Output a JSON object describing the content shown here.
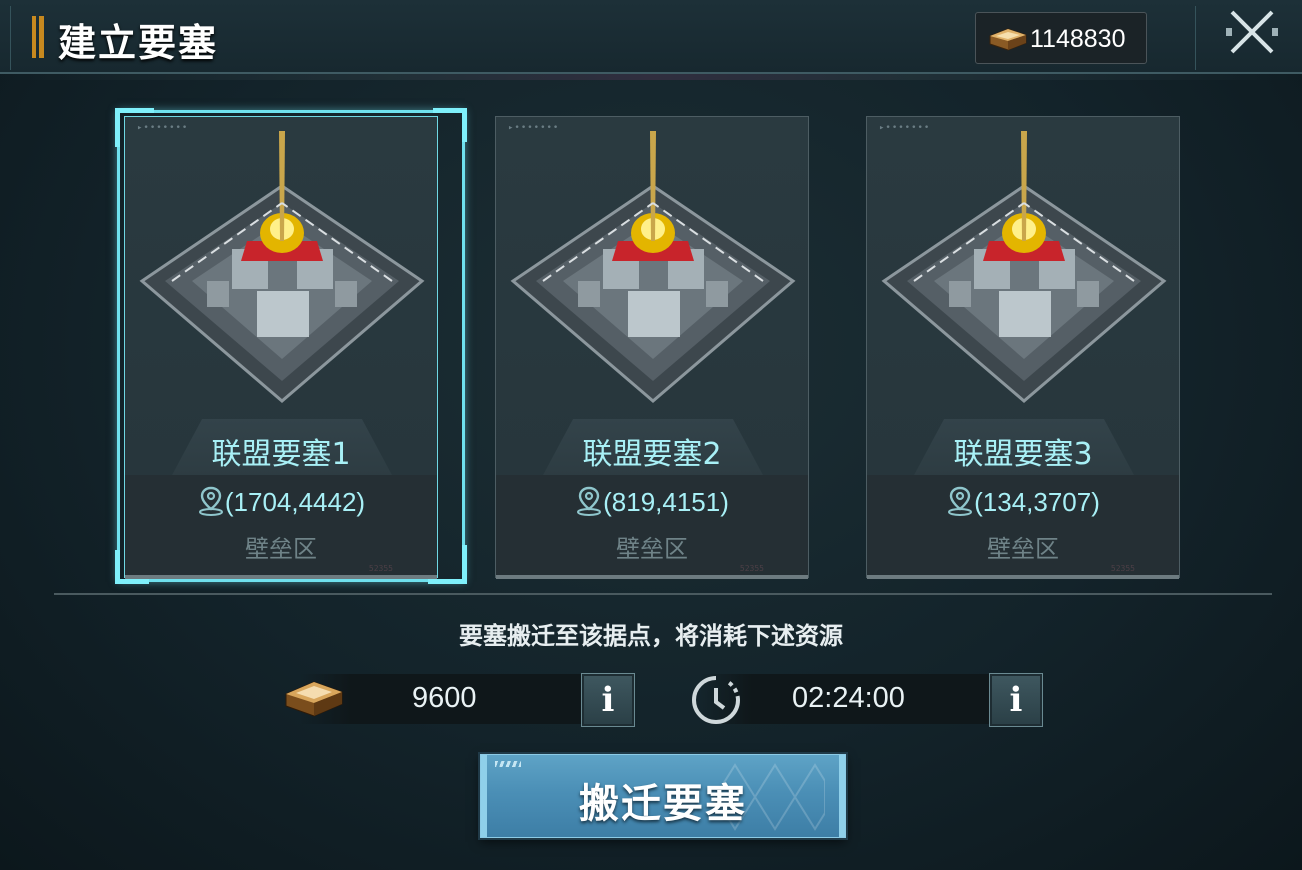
{
  "header": {
    "title": "建立要塞",
    "resource_icon": "gold-crate-icon",
    "resource_value": "1148830",
    "close_icon": "close-icon"
  },
  "fortresses": [
    {
      "name": "联盟要塞1",
      "coords": "(1704,4442)",
      "zone": "壁垒区",
      "selected": true
    },
    {
      "name": "联盟要塞2",
      "coords": "(819,4151)",
      "zone": "壁垒区",
      "selected": false
    },
    {
      "name": "联盟要塞3",
      "coords": "(134,3707)",
      "zone": "壁垒区",
      "selected": false
    }
  ],
  "cost": {
    "label": "要塞搬迁至该据点，将消耗下述资源",
    "resource_icon": "gold-crate-icon",
    "resource_amount": "9600",
    "time_icon": "timer-icon",
    "time_value": "02:24:00",
    "info_label": "i"
  },
  "action": {
    "relocate_label": "搬迁要塞"
  },
  "colors": {
    "accent_cyan": "#6fe1ee",
    "name_text": "#a8f0f6",
    "button_blue": "#4b8fb6"
  }
}
